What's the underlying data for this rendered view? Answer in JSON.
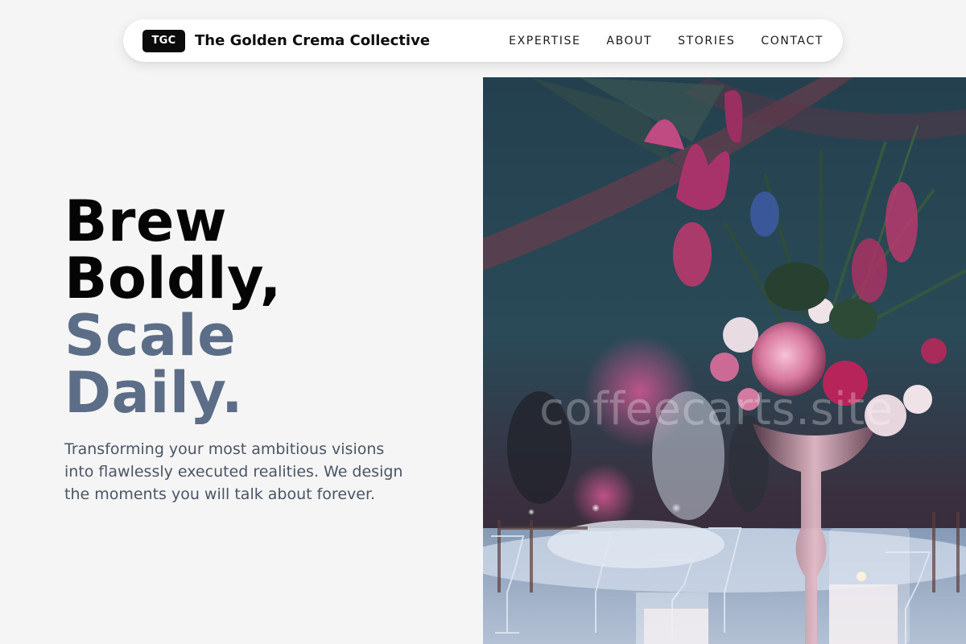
{
  "brand": {
    "logo": "TGC",
    "name": "The Golden Crema Collective"
  },
  "nav": {
    "links": [
      "EXPERTISE",
      "ABOUT",
      "STORIES",
      "CONTACT"
    ]
  },
  "hero": {
    "headline_line1": "Brew",
    "headline_line2": "Boldly,",
    "headline_line3": "Scale",
    "headline_line4": "Daily.",
    "subtext": "Transforming your most ambitious visions into flawlessly executed realities. We design the moments you will talk about forever.",
    "image_watermark": "coffeecarts.site"
  },
  "colors": {
    "background": "#f5f5f5",
    "headline_dark": "#050505",
    "headline_accent": "#5c6d87",
    "body_text": "#4a5565",
    "logo_badge": "#0b0b0b"
  }
}
